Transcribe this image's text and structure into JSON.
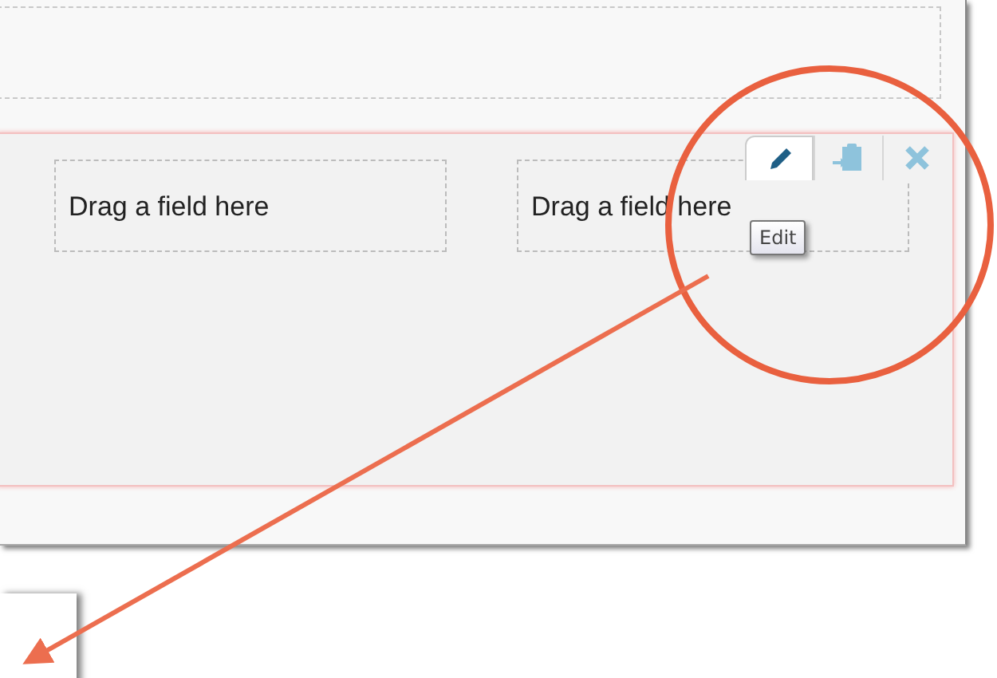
{
  "section": {
    "drop_zones": [
      "Drag a field here",
      "Drag a field here"
    ],
    "toolbar": [
      {
        "kind": "edit",
        "selected": true
      },
      {
        "kind": "paste",
        "selected": false
      },
      {
        "kind": "remove",
        "selected": false
      }
    ],
    "tooltip": "Edit"
  }
}
